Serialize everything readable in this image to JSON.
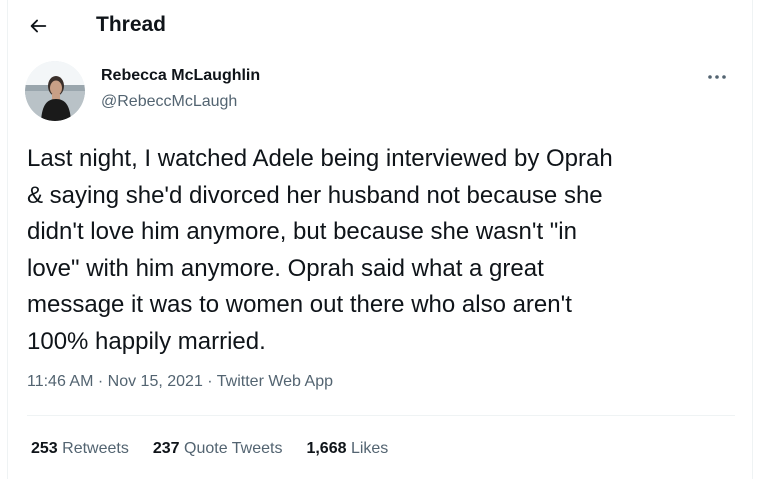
{
  "header": {
    "back_icon": "arrow-left-icon",
    "title": "Thread"
  },
  "author": {
    "avatar_icon": "profile-photo",
    "name": "Rebecca McLaughlin",
    "handle": "@RebeccMcLaugh",
    "more_icon": "more-horizontal-icon"
  },
  "tweet": {
    "text": "Last night, I watched Adele being interviewed by Oprah\n& saying she'd divorced her husband not because she\ndidn't love him anymore, but because she wasn't \"in\nlove\" with him anymore. Oprah said what a great\nmessage it was to women out there who also aren't\n100% happily married.",
    "time": "11:46 AM",
    "separator": "·",
    "date": "Nov 15, 2021",
    "source": "Twitter Web App"
  },
  "stats": {
    "retweets_count": "253",
    "retweets_label": "Retweets",
    "quote_count": "237",
    "quote_label": "Quote Tweets",
    "likes_count": "1,668",
    "likes_label": "Likes"
  },
  "colors": {
    "text_primary": "#0f1419",
    "text_secondary": "#536471",
    "divider": "#eff3f4"
  }
}
